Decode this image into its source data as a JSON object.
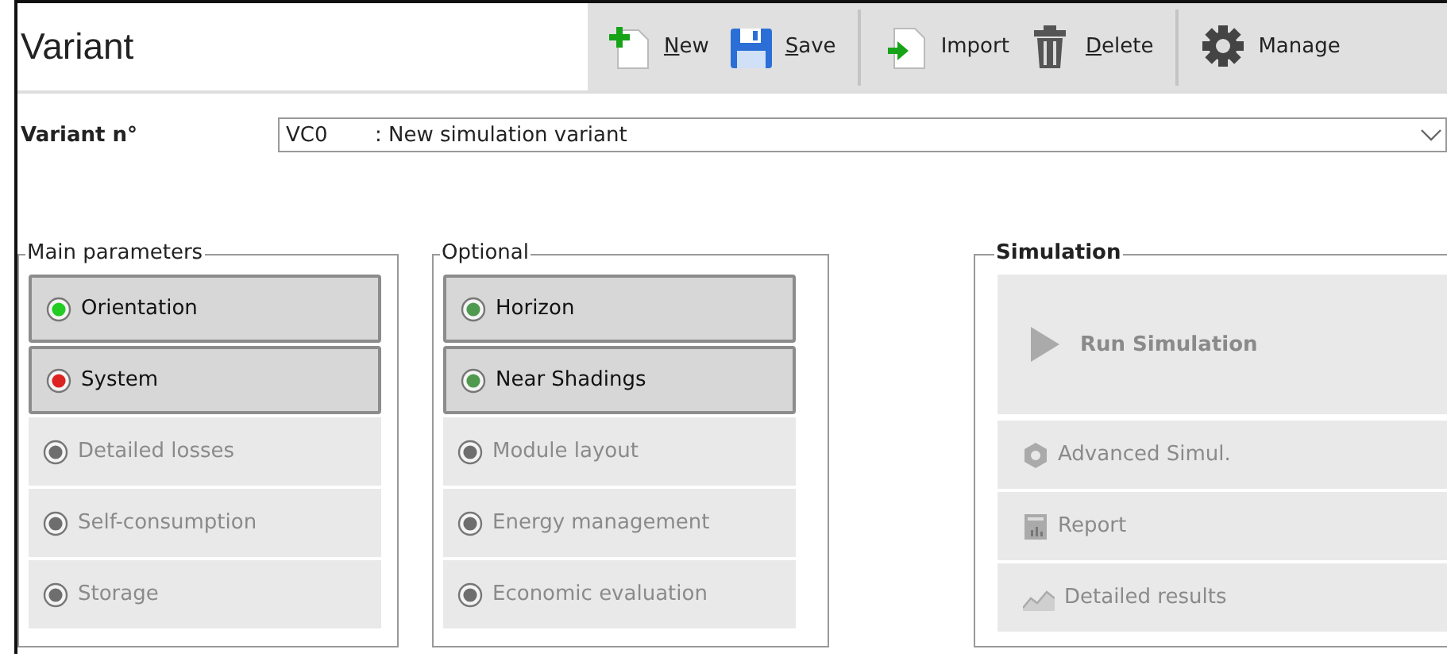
{
  "window": {
    "title": "Variant"
  },
  "toolbar": [
    {
      "kind": "new",
      "label": "New",
      "accelerator": true
    },
    {
      "kind": "save",
      "label": "Save",
      "accelerator": true
    },
    {
      "kind": "separator"
    },
    {
      "kind": "import",
      "label": "Import",
      "accelerator": false
    },
    {
      "kind": "delete",
      "label": "Delete",
      "accelerator": true
    },
    {
      "kind": "separator"
    },
    {
      "kind": "manage",
      "label": "Manage",
      "accelerator": false
    }
  ],
  "variant": {
    "label": "Variant n°",
    "code": "VC0",
    "name": ": New simulation variant"
  },
  "groups": [
    {
      "title": "Main parameters",
      "items": [
        {
          "label": "Orientation",
          "disabled": false,
          "color": "#22cc22"
        },
        {
          "label": "System",
          "disabled": false,
          "color": "#dd2222"
        },
        {
          "label": "Detailed losses",
          "disabled": true,
          "color": "#6e6e6e"
        },
        {
          "label": "Self-consumption",
          "disabled": true,
          "color": "#6e6e6e"
        },
        {
          "label": "Storage",
          "disabled": true,
          "color": "#6e6e6e"
        }
      ]
    },
    {
      "title": "Optional",
      "items": [
        {
          "label": "Horizon",
          "disabled": false,
          "color": "#4f9a4f"
        },
        {
          "label": "Near Shadings",
          "disabled": false,
          "color": "#4f9a4f"
        },
        {
          "label": "Module layout",
          "disabled": true,
          "color": "#6e6e6e"
        },
        {
          "label": "Energy management",
          "disabled": true,
          "color": "#6e6e6e"
        },
        {
          "label": "Economic evaluation",
          "disabled": true,
          "color": "#6e6e6e"
        }
      ]
    }
  ],
  "simulation": {
    "title": "Simulation",
    "run": {
      "label": "Run Simulation",
      "disabled": true
    },
    "items": [
      {
        "kind": "gear",
        "label": "Advanced Simul.",
        "disabled": true
      },
      {
        "kind": "report",
        "label": "Report",
        "disabled": true
      },
      {
        "kind": "chart",
        "label": "Detailed results",
        "disabled": true
      }
    ]
  }
}
